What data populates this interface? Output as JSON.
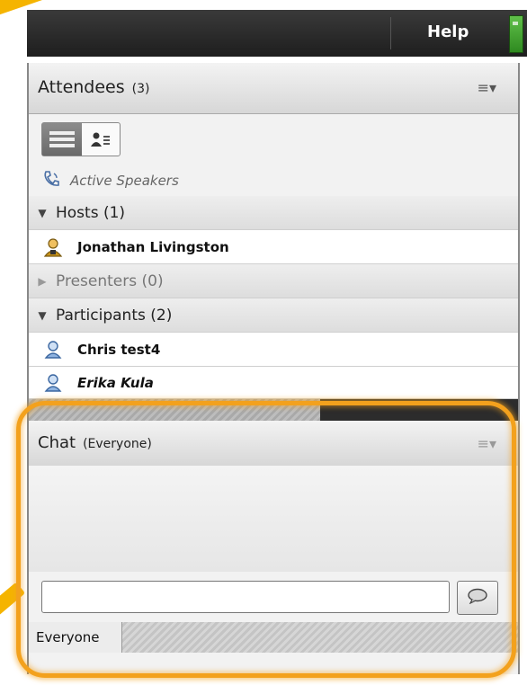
{
  "topbar": {
    "help_label": "Help"
  },
  "attendees": {
    "title": "Attendees",
    "count": "(3)",
    "active_speakers_label": "Active Speakers",
    "groups": [
      {
        "label": "Hosts (1)",
        "expanded": true
      },
      {
        "label": "Presenters (0)",
        "expanded": false
      },
      {
        "label": "Participants (2)",
        "expanded": true
      }
    ],
    "hosts": [
      "Jonathan Livingston"
    ],
    "participants": [
      "Chris test4",
      "Erika Kula"
    ]
  },
  "chat": {
    "title": "Chat",
    "scope": "(Everyone)",
    "input_value": "",
    "tab_label": "Everyone"
  },
  "colors": {
    "highlight": "#f3a11d",
    "annotation_arrow": "#f5b400",
    "signal": "#60c04a",
    "host_icon": "#c9931a",
    "participant_icon": "#5b8fd0"
  },
  "icons": {
    "menu": "menu-lines-icon",
    "view_list": "list-view-icon",
    "view_card": "user-detail-icon",
    "active_speakers": "phone-speaker-icon",
    "host": "host-user-icon",
    "participant": "participant-user-icon",
    "send": "speech-bubble-icon"
  }
}
